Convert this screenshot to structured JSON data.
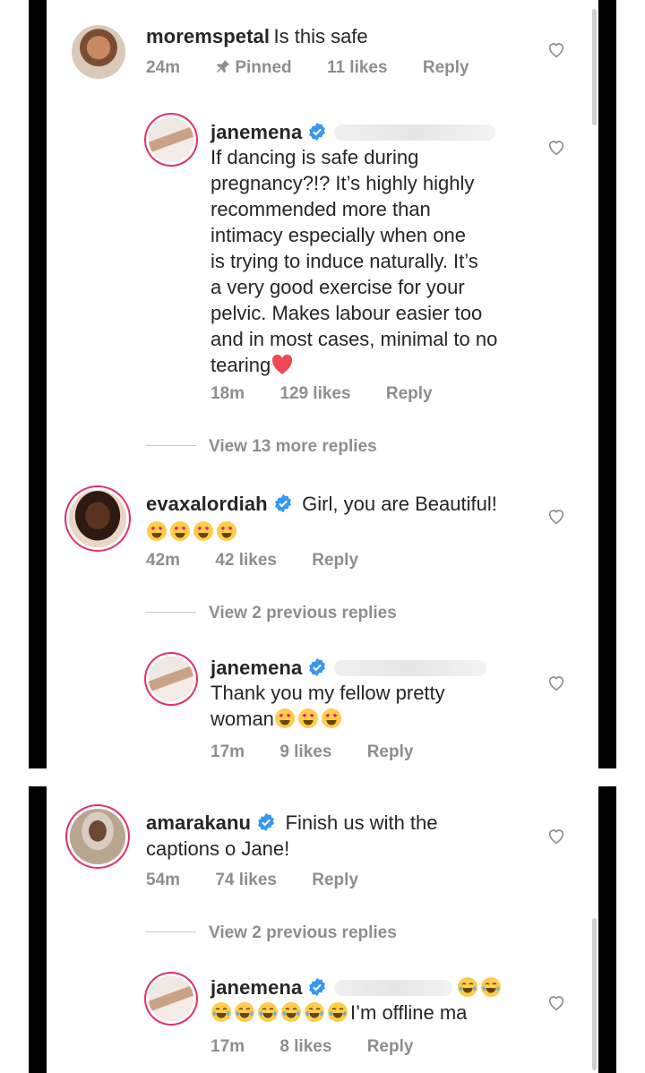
{
  "comments_top": [
    {
      "username": "moremspetal",
      "text": "Is this safe",
      "time": "24m",
      "pinned_label": "Pinned",
      "likes": "11 likes",
      "reply": "Reply"
    },
    {
      "username": "janemena",
      "lines": [
        "If dancing is safe during",
        "pregnancy?!? It’s highly highly",
        "recommended more than",
        "intimacy especially when one",
        "is trying to induce naturally. It’s",
        "a very good exercise for your",
        "pelvic. Makes labour easier too",
        "and in most cases, minimal to no",
        "tearing"
      ],
      "time": "18m",
      "likes": "129 likes",
      "reply": "Reply"
    },
    {
      "view_more": "View 13 more replies"
    },
    {
      "username": "evaxalordiah",
      "text": "Girl, you are Beautiful!",
      "time": "42m",
      "likes": "42 likes",
      "reply": "Reply"
    },
    {
      "view_more": "View 2 previous replies"
    },
    {
      "username": "janemena",
      "line1": "Thank you my fellow pretty",
      "line2": "woman",
      "time": "17m",
      "likes": "9 likes",
      "reply": "Reply"
    }
  ],
  "comments_bottom": [
    {
      "username": "amarakanu",
      "line1": "Finish us with the",
      "line2": "captions o Jane!",
      "time": "54m",
      "likes": "74 likes",
      "reply": "Reply"
    },
    {
      "view_more": "View 2 previous replies"
    },
    {
      "username": "janemena",
      "line2": "I’m offline ma",
      "time": "17m",
      "likes": "8 likes",
      "reply": "Reply"
    }
  ],
  "colors": {
    "verified": "#3897f0",
    "heart_red": "#ed4956",
    "meta_gray": "#8e8e8e",
    "story_ring": "#e1306c"
  }
}
